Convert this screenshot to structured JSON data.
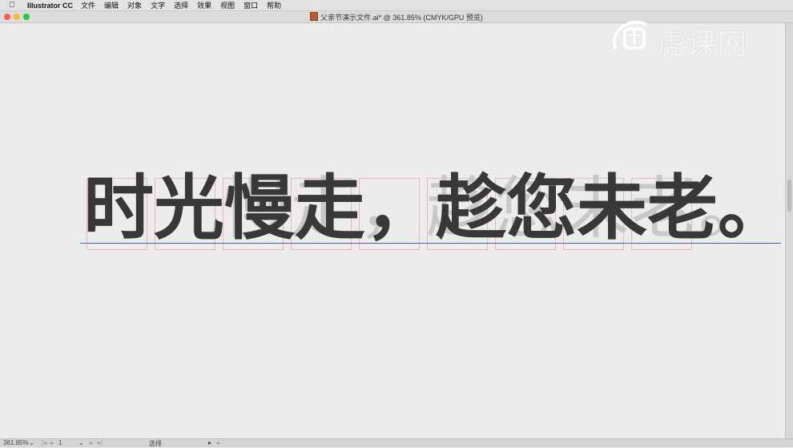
{
  "menubar": {
    "app_name": "Illustrator CC",
    "items": [
      "文件",
      "编辑",
      "对象",
      "文字",
      "选择",
      "效果",
      "视图",
      "窗口",
      "帮助"
    ]
  },
  "window": {
    "title": "父亲节演示文件.ai* @ 361.85% (CMYK/GPU 预览)"
  },
  "watermark": {
    "text": "虎课网"
  },
  "artwork": {
    "text": "时光慢走，趁您未老。",
    "ghost_text": "时光慢走，趁您未老。",
    "fill_color": "#383838",
    "ghost_color": "#c8c8c8",
    "guide_color": "#e5b9b9",
    "baseline_color": "#4a5fb3"
  },
  "statusbar": {
    "zoom": "361.85%",
    "artboard_number": "1",
    "tool_status": "选择"
  },
  "colors": {
    "close": "#fc5f57",
    "minimize": "#fdbc2e",
    "zoom": "#28c840"
  }
}
